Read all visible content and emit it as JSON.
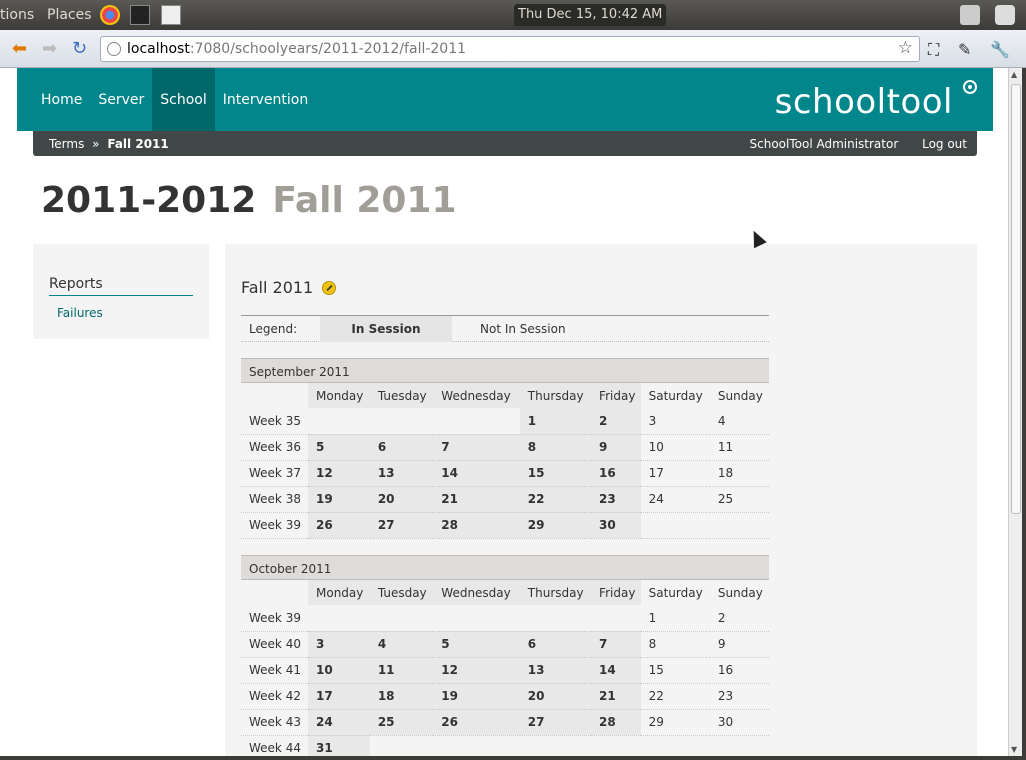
{
  "os_panel": {
    "menu_applications": "tions",
    "menu_places": "Places",
    "clock": "Thu Dec 15, 10:42 AM"
  },
  "browser": {
    "url_host": "localhost",
    "url_rest": ":7080/schoolyears/2011-2012/fall-2011"
  },
  "header": {
    "nav": [
      "Home",
      "Server",
      "School",
      "Intervention"
    ],
    "active_nav": "School",
    "logo": "schooltool"
  },
  "bar": {
    "crumb_root": "Terms",
    "crumb_sep": "»",
    "crumb_current": "Fall 2011",
    "user": "SchoolTool Administrator",
    "logout": "Log out"
  },
  "title": {
    "year": "2011-2012",
    "term": "Fall 2011"
  },
  "sidebar": {
    "heading": "Reports",
    "link": "Failures"
  },
  "calendar": {
    "title": "Fall 2011",
    "legend_label": "Legend:",
    "legend_in": "In Session",
    "legend_out": "Not In Session",
    "days": [
      "Monday",
      "Tuesday",
      "Wednesday",
      "Thursday",
      "Friday",
      "Saturday",
      "Sunday"
    ],
    "months": [
      {
        "name": "September 2011",
        "weeks": [
          {
            "label": "Week 35",
            "days": [
              "",
              "",
              "",
              "1",
              "2",
              "3",
              "4"
            ]
          },
          {
            "label": "Week 36",
            "days": [
              "5",
              "6",
              "7",
              "8",
              "9",
              "10",
              "11"
            ]
          },
          {
            "label": "Week 37",
            "days": [
              "12",
              "13",
              "14",
              "15",
              "16",
              "17",
              "18"
            ]
          },
          {
            "label": "Week 38",
            "days": [
              "19",
              "20",
              "21",
              "22",
              "23",
              "24",
              "25"
            ]
          },
          {
            "label": "Week 39",
            "days": [
              "26",
              "27",
              "28",
              "29",
              "30",
              "",
              ""
            ]
          }
        ]
      },
      {
        "name": "October 2011",
        "weeks": [
          {
            "label": "Week 39",
            "days": [
              "",
              "",
              "",
              "",
              "",
              "1",
              "2"
            ]
          },
          {
            "label": "Week 40",
            "days": [
              "3",
              "4",
              "5",
              "6",
              "7",
              "8",
              "9"
            ]
          },
          {
            "label": "Week 41",
            "days": [
              "10",
              "11",
              "12",
              "13",
              "14",
              "15",
              "16"
            ]
          },
          {
            "label": "Week 42",
            "days": [
              "17",
              "18",
              "19",
              "20",
              "21",
              "22",
              "23"
            ]
          },
          {
            "label": "Week 43",
            "days": [
              "24",
              "25",
              "26",
              "27",
              "28",
              "29",
              "30"
            ]
          },
          {
            "label": "Week 44",
            "days": [
              "31",
              "",
              "",
              "",
              "",
              "",
              ""
            ]
          }
        ]
      }
    ]
  }
}
